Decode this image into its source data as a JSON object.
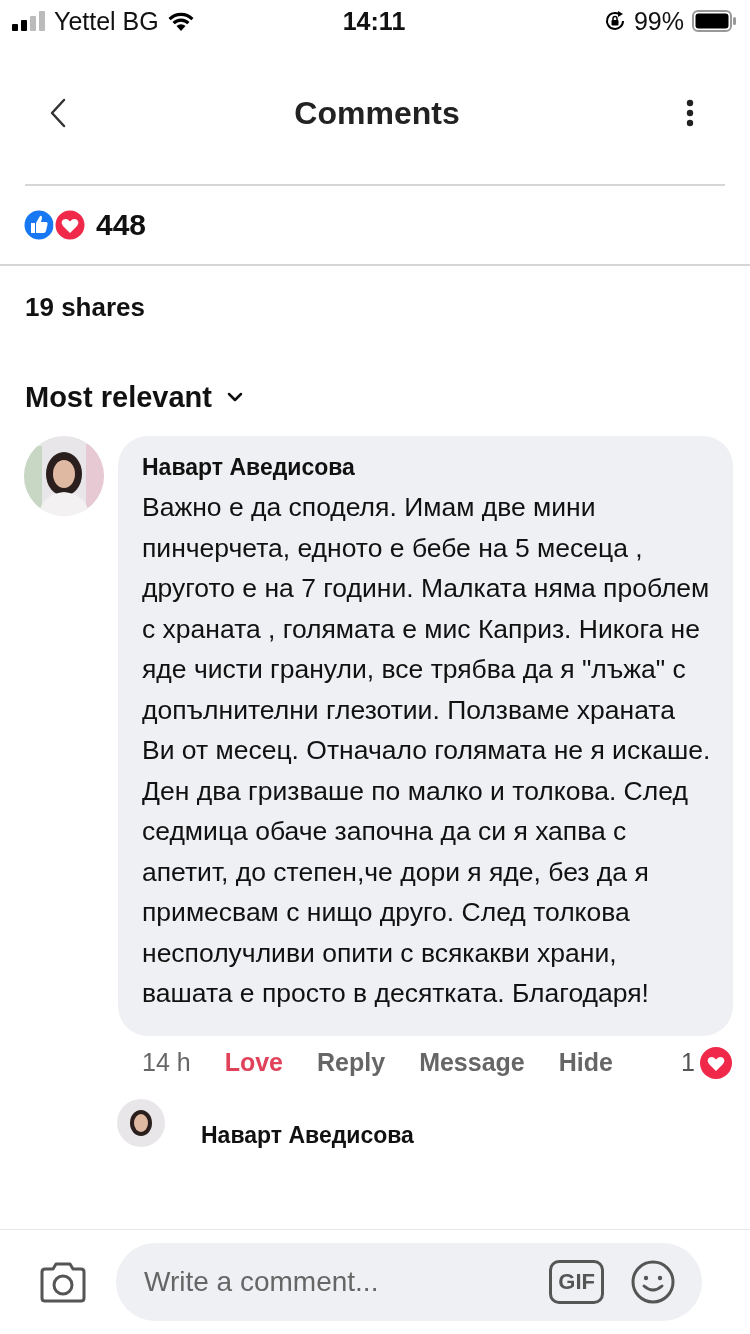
{
  "status_bar": {
    "carrier": "Yettel BG",
    "time": "14:11",
    "battery": "99%"
  },
  "header": {
    "title": "Comments"
  },
  "reactions": {
    "count": "448"
  },
  "shares": "19 shares",
  "sort": {
    "label": "Most relevant"
  },
  "comments": [
    {
      "author": "Наварт Аведисова",
      "text": "Важно е да споделя. Имам две мини пинчерчета, едното е бебе на 5 месеца , другото е на 7 години. Малката няма проблем с храната , голямата е мис Каприз. Никога не яде чисти гранули, все трябва да я \"лъжа\" с допълнителни глезотии. Ползваме храната Ви от месец. Отначало голямата не я искаше. Ден два гризваше по малко и толкова. След седмица обаче започна да си я хапва с апетит, до степен,че дори я яде, без да я примесвам с нищо друго. След толкова несполучливи опити с всякакви храни, вашата е просто в десятката. Благодаря!",
      "time": "14 h",
      "actions": [
        {
          "label": "Love",
          "selected": true
        },
        {
          "label": "Reply",
          "selected": false
        },
        {
          "label": "Message",
          "selected": false
        },
        {
          "label": "Hide",
          "selected": false
        }
      ],
      "reaction_count": "1"
    },
    {
      "author": "Наварт Аведисова"
    }
  ],
  "composer": {
    "placeholder": "Write a comment...",
    "gif": "GIF"
  }
}
